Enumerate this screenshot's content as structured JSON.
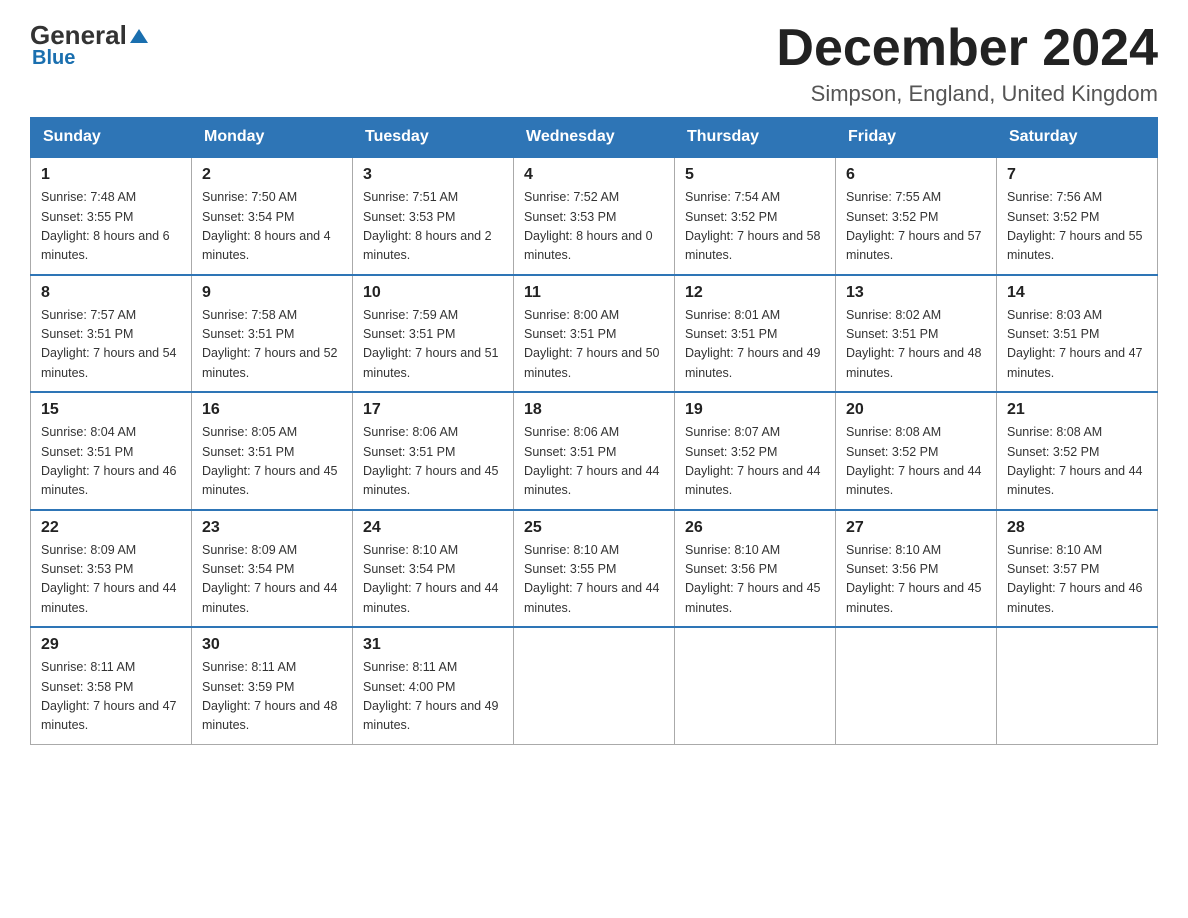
{
  "header": {
    "logo_general": "General",
    "logo_blue": "Blue",
    "main_title": "December 2024",
    "subtitle": "Simpson, England, United Kingdom"
  },
  "calendar": {
    "headers": [
      "Sunday",
      "Monday",
      "Tuesday",
      "Wednesday",
      "Thursday",
      "Friday",
      "Saturday"
    ],
    "weeks": [
      [
        {
          "day": "1",
          "sunrise": "7:48 AM",
          "sunset": "3:55 PM",
          "daylight": "8 hours and 6 minutes."
        },
        {
          "day": "2",
          "sunrise": "7:50 AM",
          "sunset": "3:54 PM",
          "daylight": "8 hours and 4 minutes."
        },
        {
          "day": "3",
          "sunrise": "7:51 AM",
          "sunset": "3:53 PM",
          "daylight": "8 hours and 2 minutes."
        },
        {
          "day": "4",
          "sunrise": "7:52 AM",
          "sunset": "3:53 PM",
          "daylight": "8 hours and 0 minutes."
        },
        {
          "day": "5",
          "sunrise": "7:54 AM",
          "sunset": "3:52 PM",
          "daylight": "7 hours and 58 minutes."
        },
        {
          "day": "6",
          "sunrise": "7:55 AM",
          "sunset": "3:52 PM",
          "daylight": "7 hours and 57 minutes."
        },
        {
          "day": "7",
          "sunrise": "7:56 AM",
          "sunset": "3:52 PM",
          "daylight": "7 hours and 55 minutes."
        }
      ],
      [
        {
          "day": "8",
          "sunrise": "7:57 AM",
          "sunset": "3:51 PM",
          "daylight": "7 hours and 54 minutes."
        },
        {
          "day": "9",
          "sunrise": "7:58 AM",
          "sunset": "3:51 PM",
          "daylight": "7 hours and 52 minutes."
        },
        {
          "day": "10",
          "sunrise": "7:59 AM",
          "sunset": "3:51 PM",
          "daylight": "7 hours and 51 minutes."
        },
        {
          "day": "11",
          "sunrise": "8:00 AM",
          "sunset": "3:51 PM",
          "daylight": "7 hours and 50 minutes."
        },
        {
          "day": "12",
          "sunrise": "8:01 AM",
          "sunset": "3:51 PM",
          "daylight": "7 hours and 49 minutes."
        },
        {
          "day": "13",
          "sunrise": "8:02 AM",
          "sunset": "3:51 PM",
          "daylight": "7 hours and 48 minutes."
        },
        {
          "day": "14",
          "sunrise": "8:03 AM",
          "sunset": "3:51 PM",
          "daylight": "7 hours and 47 minutes."
        }
      ],
      [
        {
          "day": "15",
          "sunrise": "8:04 AM",
          "sunset": "3:51 PM",
          "daylight": "7 hours and 46 minutes."
        },
        {
          "day": "16",
          "sunrise": "8:05 AM",
          "sunset": "3:51 PM",
          "daylight": "7 hours and 45 minutes."
        },
        {
          "day": "17",
          "sunrise": "8:06 AM",
          "sunset": "3:51 PM",
          "daylight": "7 hours and 45 minutes."
        },
        {
          "day": "18",
          "sunrise": "8:06 AM",
          "sunset": "3:51 PM",
          "daylight": "7 hours and 44 minutes."
        },
        {
          "day": "19",
          "sunrise": "8:07 AM",
          "sunset": "3:52 PM",
          "daylight": "7 hours and 44 minutes."
        },
        {
          "day": "20",
          "sunrise": "8:08 AM",
          "sunset": "3:52 PM",
          "daylight": "7 hours and 44 minutes."
        },
        {
          "day": "21",
          "sunrise": "8:08 AM",
          "sunset": "3:52 PM",
          "daylight": "7 hours and 44 minutes."
        }
      ],
      [
        {
          "day": "22",
          "sunrise": "8:09 AM",
          "sunset": "3:53 PM",
          "daylight": "7 hours and 44 minutes."
        },
        {
          "day": "23",
          "sunrise": "8:09 AM",
          "sunset": "3:54 PM",
          "daylight": "7 hours and 44 minutes."
        },
        {
          "day": "24",
          "sunrise": "8:10 AM",
          "sunset": "3:54 PM",
          "daylight": "7 hours and 44 minutes."
        },
        {
          "day": "25",
          "sunrise": "8:10 AM",
          "sunset": "3:55 PM",
          "daylight": "7 hours and 44 minutes."
        },
        {
          "day": "26",
          "sunrise": "8:10 AM",
          "sunset": "3:56 PM",
          "daylight": "7 hours and 45 minutes."
        },
        {
          "day": "27",
          "sunrise": "8:10 AM",
          "sunset": "3:56 PM",
          "daylight": "7 hours and 45 minutes."
        },
        {
          "day": "28",
          "sunrise": "8:10 AM",
          "sunset": "3:57 PM",
          "daylight": "7 hours and 46 minutes."
        }
      ],
      [
        {
          "day": "29",
          "sunrise": "8:11 AM",
          "sunset": "3:58 PM",
          "daylight": "7 hours and 47 minutes."
        },
        {
          "day": "30",
          "sunrise": "8:11 AM",
          "sunset": "3:59 PM",
          "daylight": "7 hours and 48 minutes."
        },
        {
          "day": "31",
          "sunrise": "8:11 AM",
          "sunset": "4:00 PM",
          "daylight": "7 hours and 49 minutes."
        },
        null,
        null,
        null,
        null
      ]
    ]
  }
}
